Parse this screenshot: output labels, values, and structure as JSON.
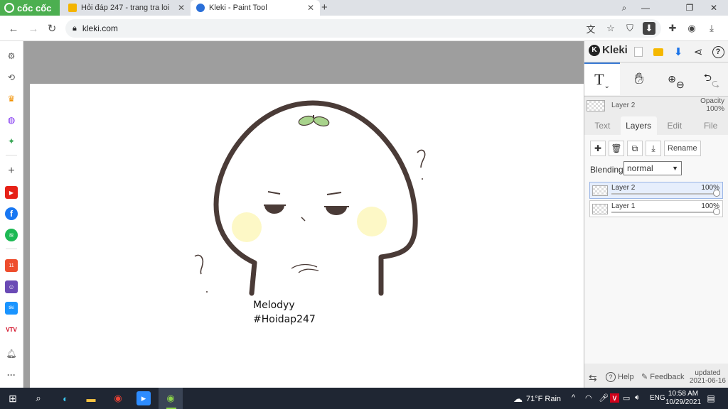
{
  "browser": {
    "brand": "cốc cốc",
    "tabs": [
      {
        "title": "Hỏi đáp 247 - trang tra loi",
        "active": false
      },
      {
        "title": "Kleki - Paint Tool",
        "active": true
      }
    ],
    "url": "kleki.com"
  },
  "kleki": {
    "app_name": "Kleki",
    "layer_name": "Layer 2",
    "opacity_label": "Opacity",
    "opacity_value": "100%",
    "panel_tabs": [
      "Text",
      "Layers",
      "Edit",
      "File"
    ],
    "active_tab": "Layers",
    "rename_label": "Rename",
    "blending_label": "Blending",
    "blending_value": "normal",
    "layers": [
      {
        "name": "Layer 2",
        "opacity": "100%",
        "selected": true
      },
      {
        "name": "Layer 1",
        "opacity": "100%",
        "selected": false
      }
    ],
    "footer": {
      "help": "Help",
      "feedback": "Feedback",
      "updated_label": "updated",
      "updated_date": "2021-06-16"
    }
  },
  "canvas": {
    "text_line1": "Melodyy",
    "text_line2": "#Hoidap247"
  },
  "taskbar": {
    "weather": "71°F  Rain",
    "language": "ENG",
    "time": "10:58 AM",
    "date": "10/29/2021"
  },
  "colors": {
    "accent": "#3a7bd5",
    "coccoc_green": "#4caf50",
    "taskbar": "#1f2633",
    "stroke": "#4a3b37"
  }
}
